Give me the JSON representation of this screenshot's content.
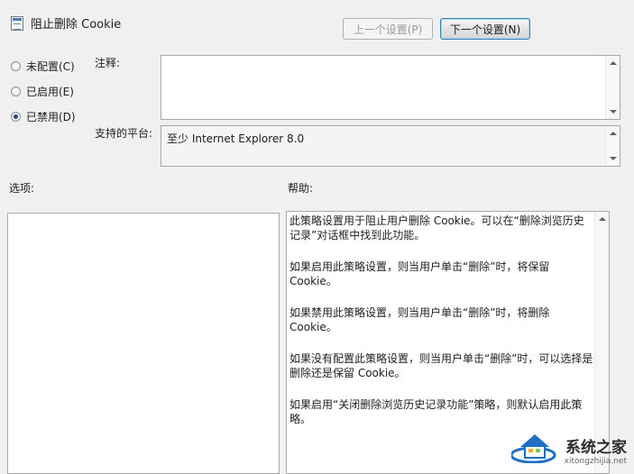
{
  "header": {
    "title": "阻止删除 Cookie",
    "prev_button": "上一个设置(P)",
    "next_button": "下一个设置(N)"
  },
  "state": {
    "options": [
      {
        "label": "未配置(C)",
        "checked": false
      },
      {
        "label": "已启用(E)",
        "checked": false
      },
      {
        "label": "已禁用(D)",
        "checked": true
      }
    ]
  },
  "comment": {
    "label": "注释:",
    "value": ""
  },
  "platform": {
    "label": "支持的平台:",
    "value": "至少 Internet Explorer 8.0"
  },
  "options_section": {
    "label": "选项:"
  },
  "help_section": {
    "label": "帮助:",
    "paragraphs": [
      "此策略设置用于阻止用户删除 Cookie。可以在“删除浏览历史记录”对话框中找到此功能。",
      "如果启用此策略设置，则当用户单击“删除”时，将保留 Cookie。",
      "如果禁用此策略设置，则当用户单击“删除”时，将删除 Cookie。",
      "如果没有配置此策略设置，则当用户单击“删除”时，可以选择是删除还是保留 Cookie。",
      "如果启用“关闭删除浏览历史记录功能”策略，则默认启用此策略。"
    ]
  },
  "watermark": {
    "text": "系统之家",
    "subtext": "xitongzhijia.net"
  },
  "colors": {
    "selected_radio": "#2a4a7a",
    "watermark_blue": "#1f6fc5"
  }
}
